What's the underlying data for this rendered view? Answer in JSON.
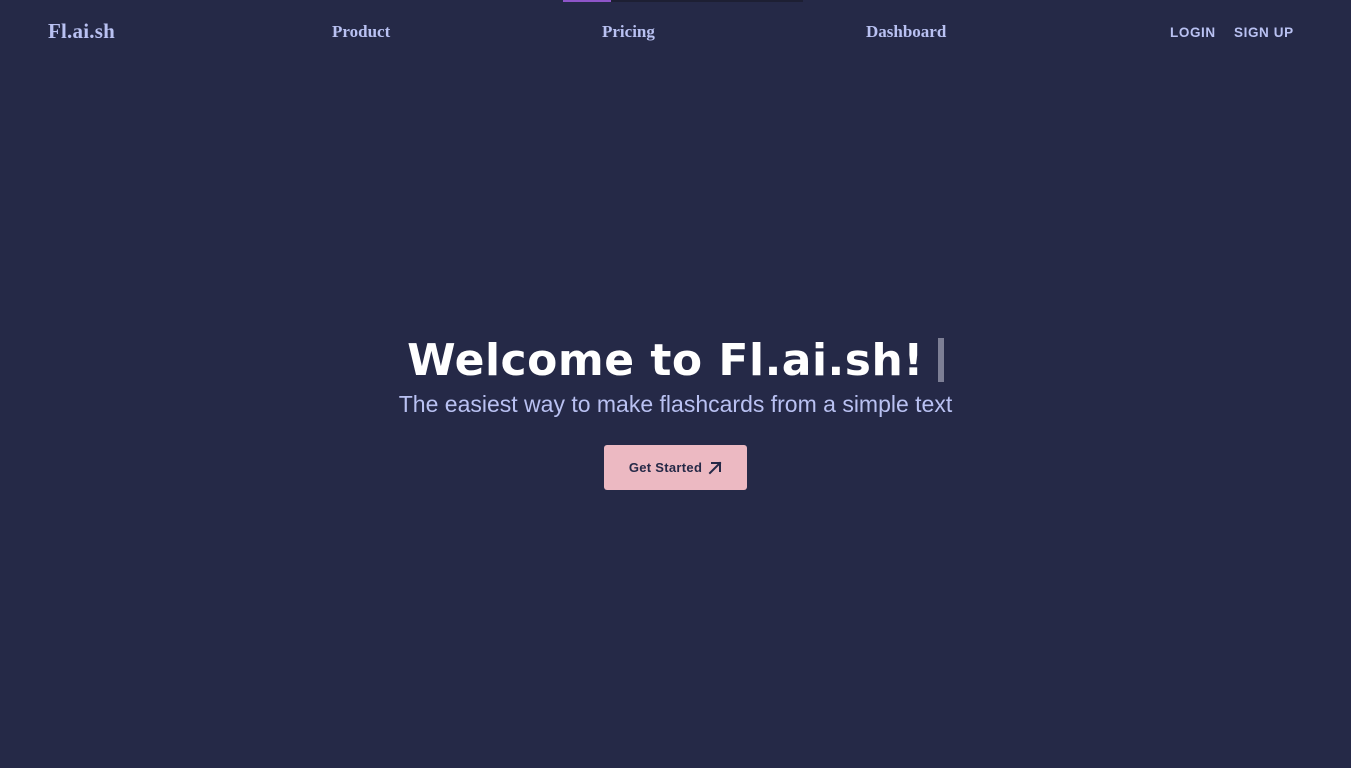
{
  "nav": {
    "brand": "Fl.ai.sh",
    "links": [
      "Product",
      "Pricing",
      "Dashboard"
    ],
    "login": "LOGIN",
    "signup": "SIGN UP"
  },
  "hero": {
    "title": "Welcome to Fl.ai.sh!",
    "subtitle": "The easiest way to make flashcards from a simple text",
    "cta_label": "Get Started",
    "cta_icon": "arrow-up-right-icon"
  },
  "colors": {
    "background": "#252947",
    "nav_text": "#b9c1f2",
    "title": "#ffffff",
    "cta_bg": "#ecb9c2",
    "cta_text": "#252947",
    "accent": "#8e55c9"
  }
}
